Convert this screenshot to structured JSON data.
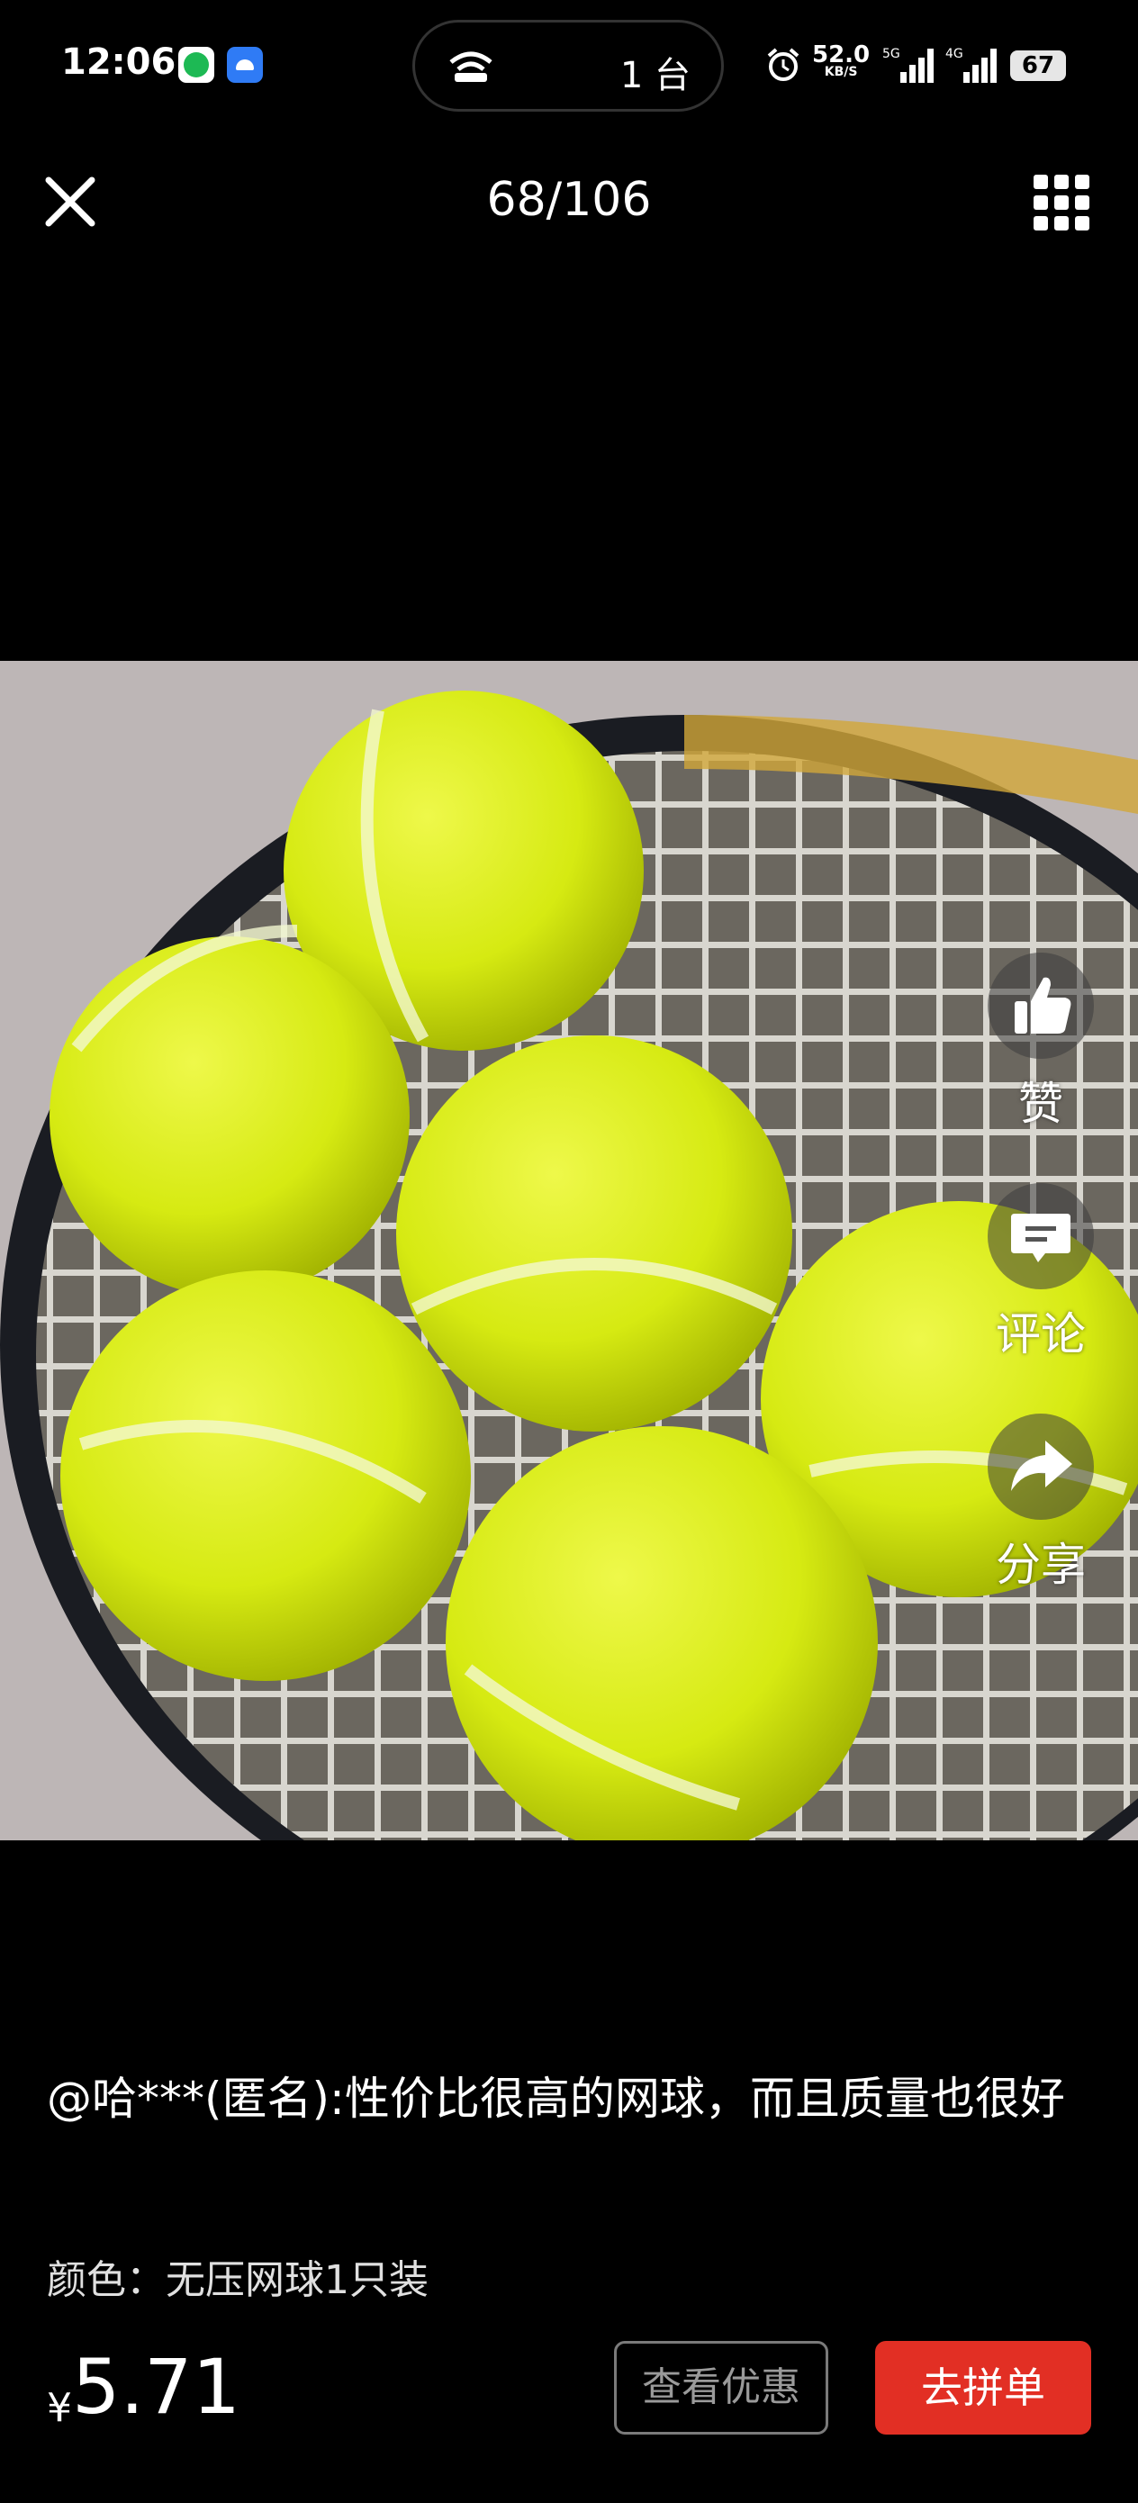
{
  "status_bar": {
    "time": "12:06",
    "connected_devices": "1 台",
    "net_speed": "52.0",
    "net_speed_unit": "KB/S",
    "battery": "67"
  },
  "nav": {
    "counter": "68/106"
  },
  "actions": {
    "like_label": "赞",
    "comment_label": "评论",
    "share_label": "分享"
  },
  "review": {
    "text": "@哈***(匿名):性价比很高的网球，而且质量也很好",
    "variant": "颜色：无压网球1只装"
  },
  "footer": {
    "currency": "¥",
    "price": "5.71",
    "coupon_label": "查看优惠",
    "buy_label": "去拼单"
  },
  "colors": {
    "background": "#000000",
    "buy_button": "#e22f24",
    "ball_yellow": "#d9ec1a"
  }
}
